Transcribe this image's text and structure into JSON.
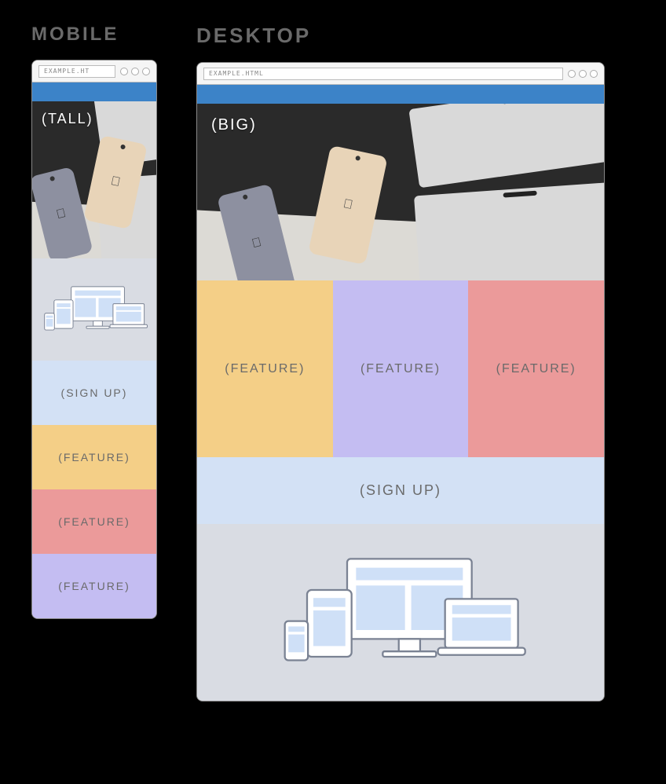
{
  "headings": {
    "mobile": "MOBILE",
    "desktop": "DESKTOP"
  },
  "address_bar": {
    "mobile": "EXAMPLE.HT",
    "desktop": "EXAMPLE.HTML"
  },
  "hero": {
    "mobile_label": "(TALL)",
    "desktop_label": "(BIG)"
  },
  "blocks": {
    "signup": "(SIGN UP)",
    "feature": "(FEATURE)"
  },
  "colors": {
    "bluebar": "#3C83C8",
    "feature_yellow": "#F4CF87",
    "feature_red": "#EB9A9A",
    "feature_purple": "#C4BDF2",
    "signup": "#D3E1F5",
    "illustration_bg": "#D9DCE3"
  },
  "mobile_order": [
    "hero_tall",
    "illustration",
    "signup",
    "feature_yellow",
    "feature_red",
    "feature_purple"
  ],
  "desktop_order": [
    "hero_big",
    "features_row",
    "signup",
    "illustration"
  ]
}
